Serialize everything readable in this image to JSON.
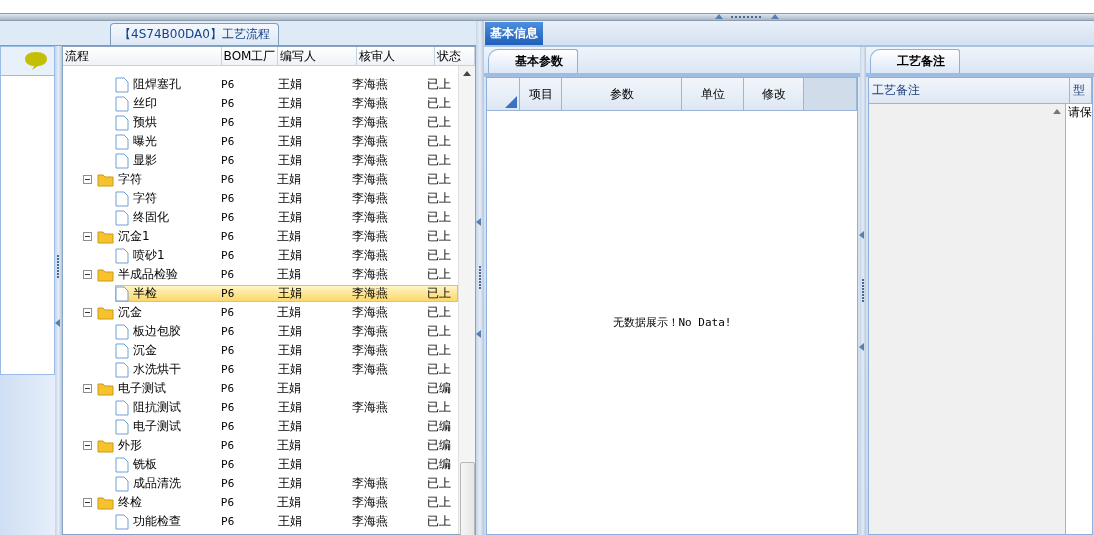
{
  "left_panel": {
    "title": "【4S74B00DA0】工艺流程"
  },
  "tree": {
    "columns": [
      "流程",
      "BOM工厂",
      "编写人",
      "核审人",
      "状态"
    ],
    "rows": [
      {
        "kind": "file",
        "label": "阻焊塞孔",
        "bom": "P6",
        "writer": "王娟",
        "reviewer": "李海燕",
        "status": "已上",
        "selected": false
      },
      {
        "kind": "file",
        "label": "丝印",
        "bom": "P6",
        "writer": "王娟",
        "reviewer": "李海燕",
        "status": "已上",
        "selected": false
      },
      {
        "kind": "file",
        "label": "预烘",
        "bom": "P6",
        "writer": "王娟",
        "reviewer": "李海燕",
        "status": "已上",
        "selected": false
      },
      {
        "kind": "file",
        "label": "曝光",
        "bom": "P6",
        "writer": "王娟",
        "reviewer": "李海燕",
        "status": "已上",
        "selected": false
      },
      {
        "kind": "file",
        "label": "显影",
        "bom": "P6",
        "writer": "王娟",
        "reviewer": "李海燕",
        "status": "已上",
        "selected": false
      },
      {
        "kind": "folder",
        "label": "字符",
        "bom": "P6",
        "writer": "王娟",
        "reviewer": "李海燕",
        "status": "已上",
        "selected": false,
        "expanded": true,
        "children": [
          {
            "kind": "file",
            "label": "字符",
            "bom": "P6",
            "writer": "王娟",
            "reviewer": "李海燕",
            "status": "已上",
            "selected": false
          },
          {
            "kind": "file",
            "label": "终固化",
            "bom": "P6",
            "writer": "王娟",
            "reviewer": "李海燕",
            "status": "已上",
            "selected": false
          }
        ]
      },
      {
        "kind": "folder",
        "label": "沉金1",
        "bom": "P6",
        "writer": "王娟",
        "reviewer": "李海燕",
        "status": "已上",
        "selected": false,
        "expanded": true,
        "children": [
          {
            "kind": "file",
            "label": "喷砂1",
            "bom": "P6",
            "writer": "王娟",
            "reviewer": "李海燕",
            "status": "已上",
            "selected": false
          }
        ]
      },
      {
        "kind": "folder",
        "label": "半成品检验",
        "bom": "P6",
        "writer": "王娟",
        "reviewer": "李海燕",
        "status": "已上",
        "selected": false,
        "expanded": true,
        "children": [
          {
            "kind": "file",
            "label": "半检",
            "bom": "P6",
            "writer": "王娟",
            "reviewer": "李海燕",
            "status": "已上",
            "selected": true
          }
        ]
      },
      {
        "kind": "folder",
        "label": "沉金",
        "bom": "P6",
        "writer": "王娟",
        "reviewer": "李海燕",
        "status": "已上",
        "selected": false,
        "expanded": true,
        "children": [
          {
            "kind": "file",
            "label": "板边包胶",
            "bom": "P6",
            "writer": "王娟",
            "reviewer": "李海燕",
            "status": "已上",
            "selected": false
          },
          {
            "kind": "file",
            "label": "沉金",
            "bom": "P6",
            "writer": "王娟",
            "reviewer": "李海燕",
            "status": "已上",
            "selected": false
          },
          {
            "kind": "file",
            "label": "水洗烘干",
            "bom": "P6",
            "writer": "王娟",
            "reviewer": "李海燕",
            "status": "已上",
            "selected": false
          }
        ]
      },
      {
        "kind": "folder",
        "label": "电子测试",
        "bom": "P6",
        "writer": "王娟",
        "status": "已编",
        "selected": false,
        "expanded": true,
        "children": [
          {
            "kind": "file",
            "label": "阻抗测试",
            "bom": "P6",
            "writer": "王娟",
            "reviewer": "李海燕",
            "status": "已上",
            "selected": false
          },
          {
            "kind": "file",
            "label": "电子测试",
            "bom": "P6",
            "writer": "王娟",
            "status": "已编",
            "selected": false
          }
        ]
      },
      {
        "kind": "folder",
        "label": "外形",
        "bom": "P6",
        "writer": "王娟",
        "status": "已编",
        "selected": false,
        "expanded": true,
        "children": [
          {
            "kind": "file",
            "label": "铣板",
            "bom": "P6",
            "writer": "王娟",
            "status": "已编",
            "selected": false
          },
          {
            "kind": "file",
            "label": "成品清洗",
            "bom": "P6",
            "writer": "王娟",
            "reviewer": "李海燕",
            "status": "已上",
            "selected": false
          }
        ]
      },
      {
        "kind": "folder",
        "label": "终检",
        "bom": "P6",
        "writer": "王娟",
        "reviewer": "李海燕",
        "status": "已上",
        "selected": false,
        "expanded": true,
        "children": [
          {
            "kind": "file",
            "label": "功能检查",
            "bom": "P6",
            "writer": "王娟",
            "reviewer": "李海燕",
            "status": "已上",
            "selected": false
          }
        ]
      }
    ]
  },
  "main_tabs": [
    {
      "label": "基本信息",
      "selected": true
    }
  ],
  "params_panel": {
    "tab": "基本参数",
    "columns": [
      "项目",
      "参数",
      "单位",
      "修改"
    ],
    "empty_message": "无数据展示！No Data!"
  },
  "notes_panel": {
    "tab": "工艺备注",
    "columns": [
      "工艺备注",
      "型"
    ],
    "cell_text": "请保"
  }
}
